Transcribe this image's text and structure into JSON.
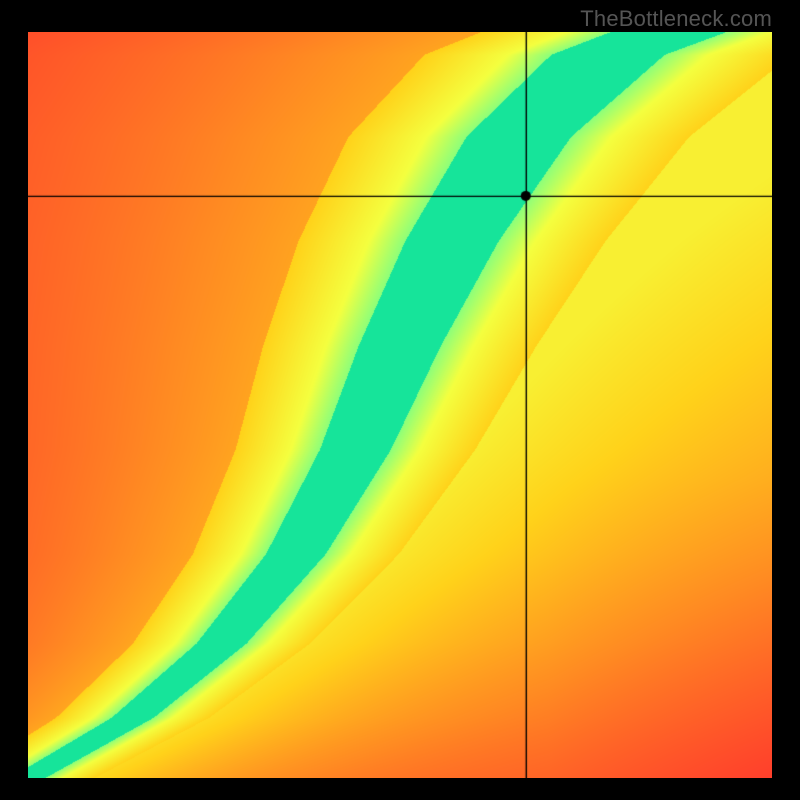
{
  "watermark": "TheBottleneck.com",
  "chart_data": {
    "type": "heatmap",
    "title": "",
    "xlabel": "",
    "ylabel": "",
    "xlim": [
      0,
      100
    ],
    "ylim": [
      0,
      100
    ],
    "colormap_stops": [
      {
        "t": 0.0,
        "color": "#ff2a2e"
      },
      {
        "t": 0.3,
        "color": "#ff8a22"
      },
      {
        "t": 0.55,
        "color": "#ffd21a"
      },
      {
        "t": 0.78,
        "color": "#f4ff3f"
      },
      {
        "t": 0.9,
        "color": "#8dff7a"
      },
      {
        "t": 1.0,
        "color": "#16e49a"
      }
    ],
    "ridge_polyline": [
      {
        "x": 0,
        "y": 0
      },
      {
        "x": 14,
        "y": 8
      },
      {
        "x": 26,
        "y": 18
      },
      {
        "x": 36,
        "y": 30
      },
      {
        "x": 44,
        "y": 44
      },
      {
        "x": 50,
        "y": 58
      },
      {
        "x": 57,
        "y": 72
      },
      {
        "x": 66,
        "y": 86
      },
      {
        "x": 78,
        "y": 97
      },
      {
        "x": 86,
        "y": 100
      }
    ],
    "ridge_width_fraction": 0.06,
    "yellow_halo_width_fraction": 0.18,
    "crosshair": {
      "x": 67,
      "y": 78
    },
    "marker": {
      "x": 67,
      "y": 78,
      "radius_px": 5
    },
    "description": "Green ridge curves from lower-left to upper-right. Marker sits on the upper-right yellow-to-green transition; left-of-ridge background shifts red→orange, right-of-ridge shifts yellow→orange toward the far corner."
  }
}
